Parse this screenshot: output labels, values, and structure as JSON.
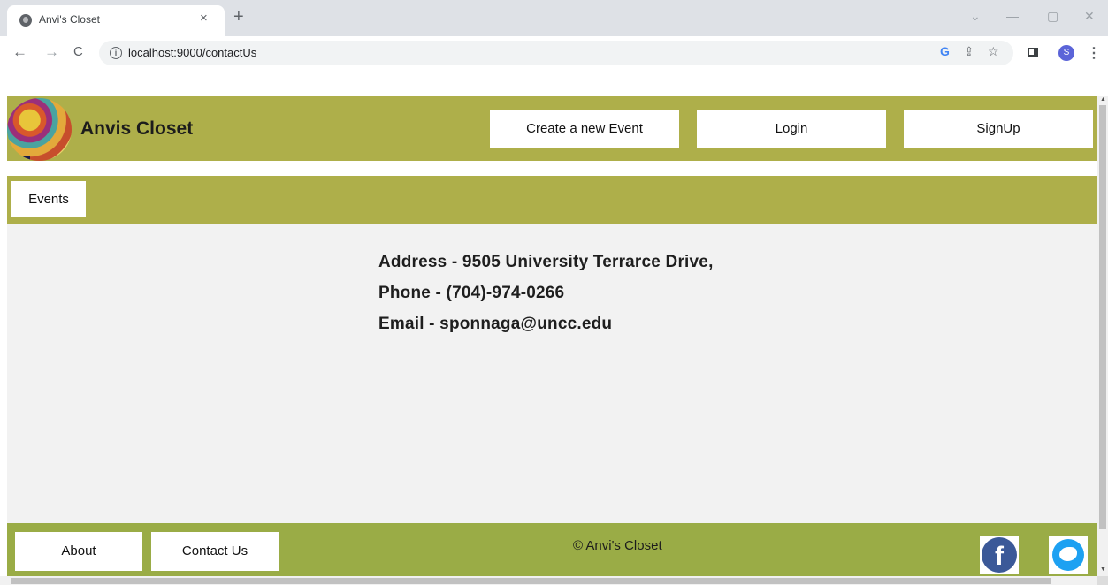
{
  "browser": {
    "tab_title": "Anvi's Closet",
    "tab_close": "×",
    "new_tab": "+",
    "back": "←",
    "forward": "→",
    "reload": "C",
    "url": "localhost:9000/contactUs",
    "profile_initial": "S",
    "window_controls": [
      "⌄",
      "—",
      "▢",
      "✕"
    ],
    "omnibox_icons": [
      "G",
      "⇪",
      "☆"
    ]
  },
  "header": {
    "brand": "Anvis Closet",
    "buttons": [
      "Create a new Event",
      "Login",
      "SignUp"
    ]
  },
  "subnav": {
    "events_label": "Events"
  },
  "contact": {
    "address": "Address - 9505 University Terrarce Drive,",
    "phone": "Phone - (704)-974-0266",
    "email": "Email - sponnaga@uncc.edu"
  },
  "footer": {
    "about_label": "About",
    "contact_label": "Contact Us",
    "copyright": "© Anvi's Closet",
    "facebook_glyph": "f"
  },
  "colors": {
    "header_bg": "#aeaf4a",
    "footer_bg": "#9aac46",
    "content_bg": "#f2f2f2"
  },
  "icons": [
    "globe-icon",
    "info-icon",
    "google-icon",
    "share-icon",
    "star-icon",
    "side-panel-icon",
    "facebook-icon",
    "twitter-icon"
  ]
}
